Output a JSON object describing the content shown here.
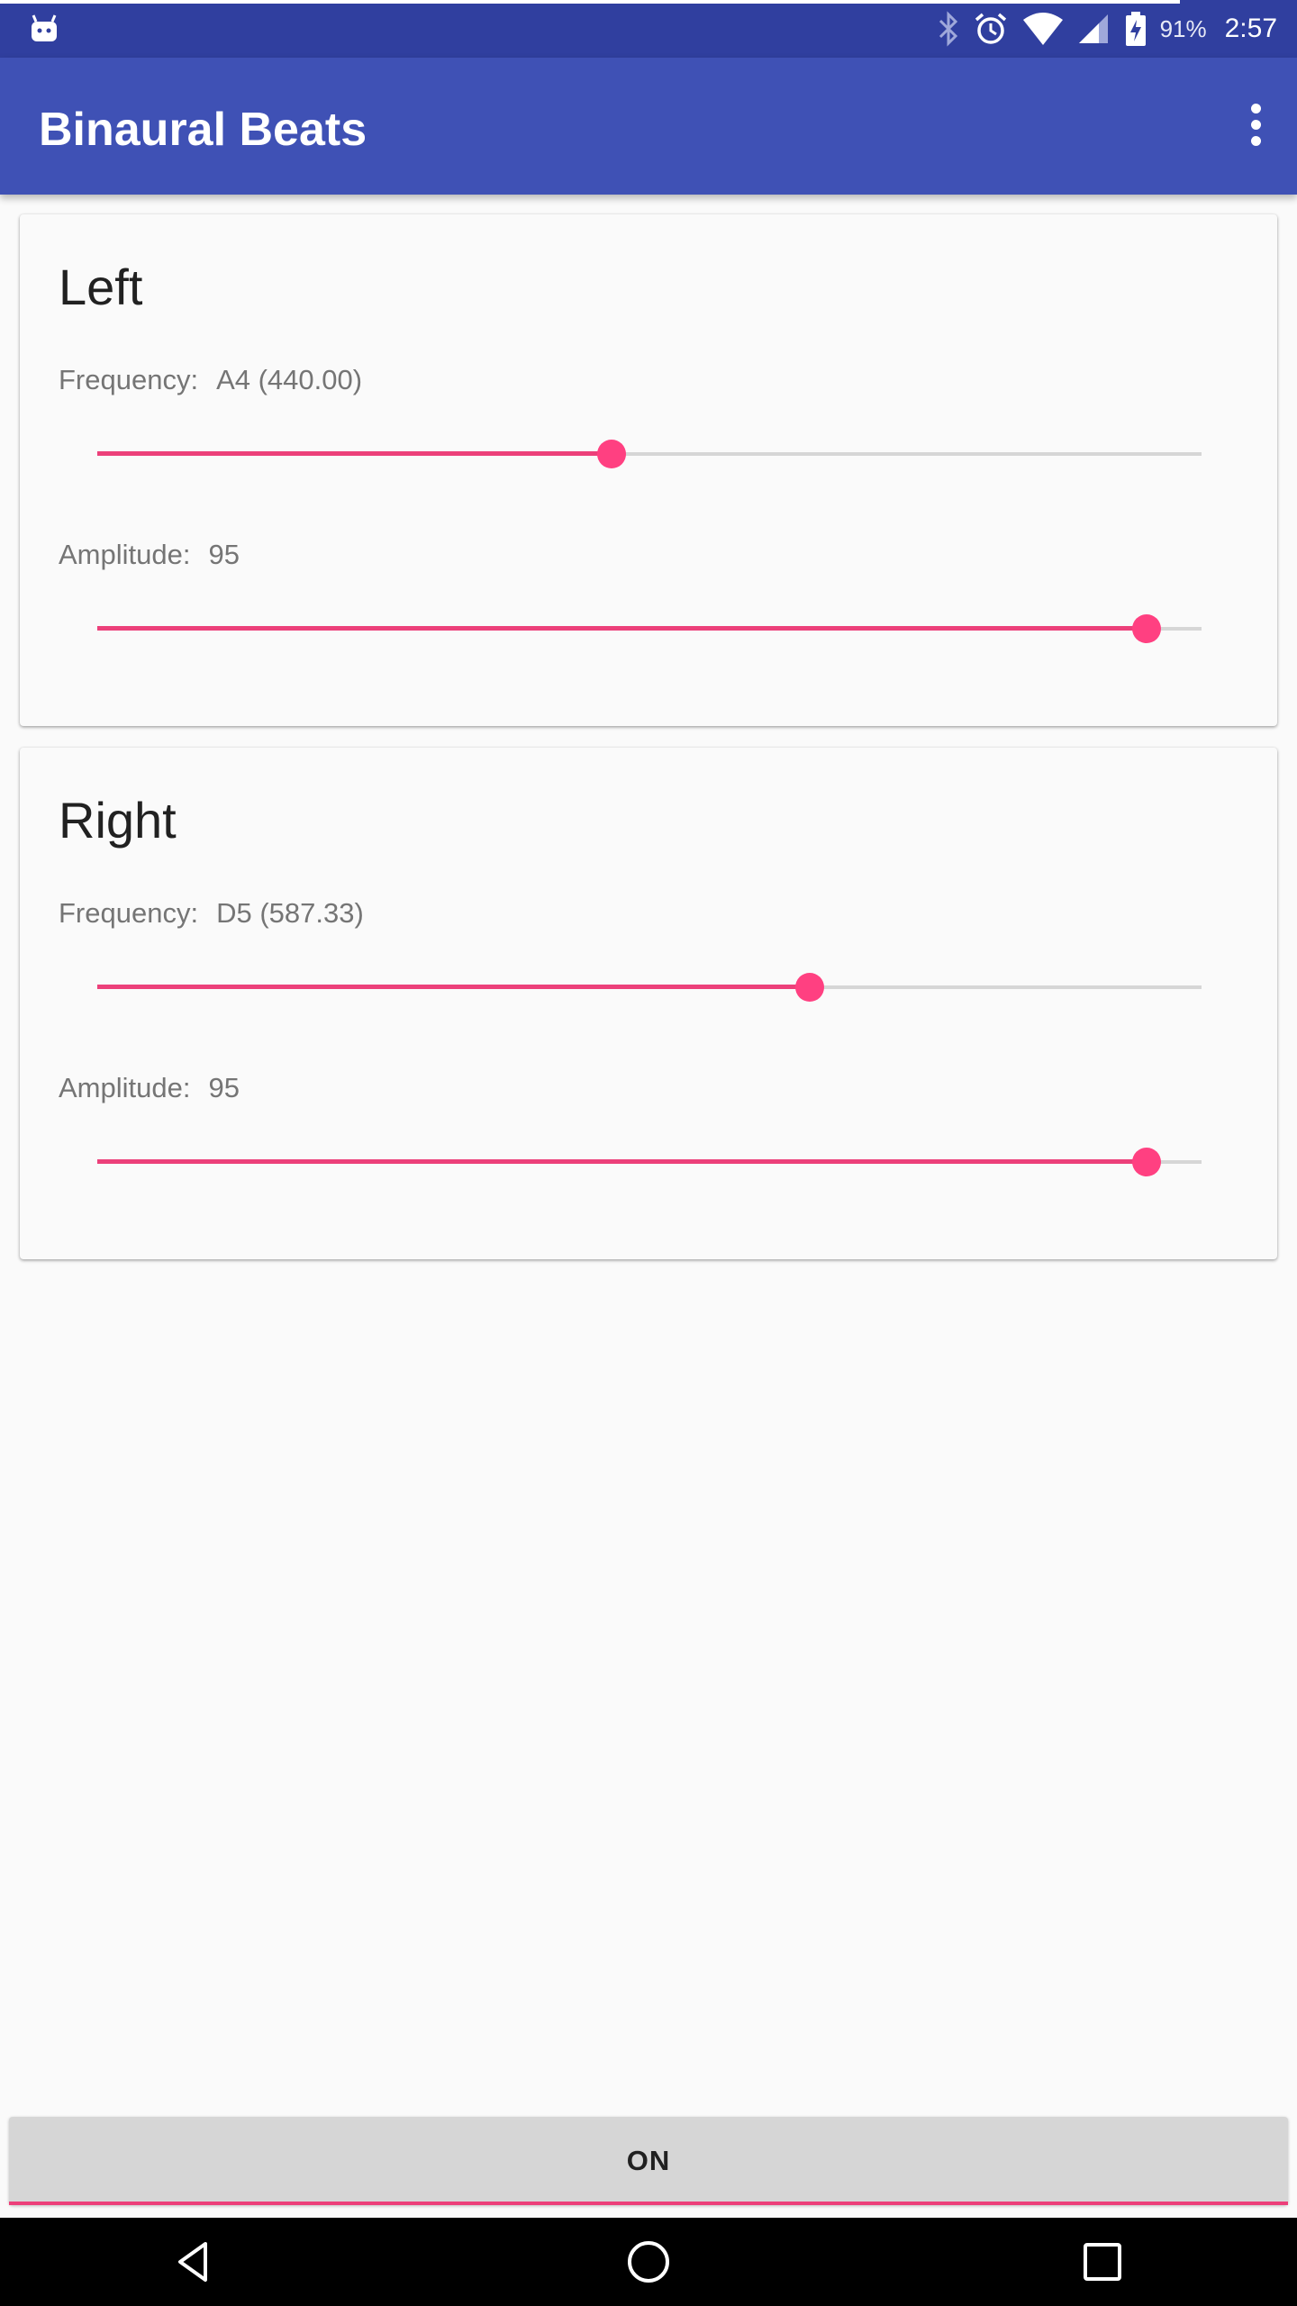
{
  "status_bar": {
    "battery_percent": "91%",
    "time": "2:57"
  },
  "app_bar": {
    "title": "Binaural Beats"
  },
  "channels": [
    {
      "title": "Left",
      "frequency_label": "Frequency:",
      "frequency_value": "A4 (440.00)",
      "frequency_fraction": 0.466,
      "amplitude_label": "Amplitude:",
      "amplitude_value": "95",
      "amplitude_fraction": 0.95
    },
    {
      "title": "Right",
      "frequency_label": "Frequency:",
      "frequency_value": "D5 (587.33)",
      "frequency_fraction": 0.645,
      "amplitude_label": "Amplitude:",
      "amplitude_value": "95",
      "amplitude_fraction": 0.95
    }
  ],
  "toggle_button": {
    "label": "ON"
  },
  "colors": {
    "status_bar": "#303f9f",
    "primary": "#3f51b5",
    "accent": "#ff4081"
  }
}
